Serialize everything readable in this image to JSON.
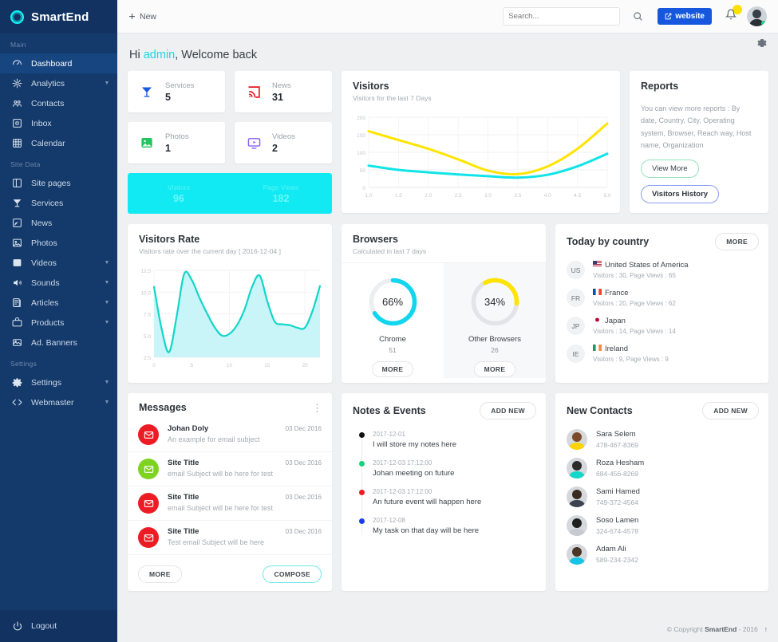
{
  "brand": {
    "name": "SmartEnd"
  },
  "sidebar": {
    "sections": [
      {
        "title": "Main",
        "items": [
          {
            "label": "Dashboard",
            "icon": "dashboard-icon",
            "caret": false,
            "active": true
          },
          {
            "label": "Analytics",
            "icon": "analytics-icon",
            "caret": true
          },
          {
            "label": "Contacts",
            "icon": "contacts-icon",
            "caret": false
          },
          {
            "label": "Inbox",
            "icon": "inbox-icon",
            "caret": false
          },
          {
            "label": "Calendar",
            "icon": "calendar-icon",
            "caret": false
          }
        ]
      },
      {
        "title": "Site Data",
        "items": [
          {
            "label": "Site pages",
            "icon": "site-pages-icon",
            "caret": false
          },
          {
            "label": "Services",
            "icon": "services-icon",
            "caret": false
          },
          {
            "label": "News",
            "icon": "news-icon",
            "caret": false
          },
          {
            "label": "Photos",
            "icon": "photos-icon",
            "caret": false
          },
          {
            "label": "Videos",
            "icon": "videos-icon",
            "caret": true
          },
          {
            "label": "Sounds",
            "icon": "sounds-icon",
            "caret": true
          },
          {
            "label": "Articles",
            "icon": "articles-icon",
            "caret": true
          },
          {
            "label": "Products",
            "icon": "products-icon",
            "caret": true
          },
          {
            "label": "Ad. Banners",
            "icon": "ad-banners-icon",
            "caret": false
          }
        ]
      },
      {
        "title": "Settings",
        "items": [
          {
            "label": "Settings",
            "icon": "gear-icon",
            "caret": true
          },
          {
            "label": "Webmaster",
            "icon": "code-icon",
            "caret": true
          }
        ]
      }
    ],
    "logout": "Logout"
  },
  "topbar": {
    "new_label": "New",
    "search_placeholder": "Search...",
    "search_value": "",
    "website_label": "website"
  },
  "welcome": {
    "hi": "Hi ",
    "user": "admin",
    "rest": ", Welcome back"
  },
  "stats": [
    {
      "label": "Services",
      "value": "5",
      "icon": "cocktail-icon",
      "color": "#1757dd"
    },
    {
      "label": "News",
      "value": "31",
      "icon": "rss-icon",
      "color": "#e8131d"
    },
    {
      "label": "Photos",
      "value": "1",
      "icon": "image-icon",
      "color": "#22c55e"
    },
    {
      "label": "Videos",
      "value": "2",
      "icon": "video-icon",
      "color": "#8b5cf6"
    }
  ],
  "banner": {
    "cells": [
      {
        "label": "Visitors",
        "value": "96"
      },
      {
        "label": "Page Views",
        "value": "182"
      }
    ]
  },
  "visitors_card": {
    "title": "Visitors",
    "subtitle": "Visitors for the last 7 Days"
  },
  "reports": {
    "title": "Reports",
    "text": "You can view more reports : By date, Country, City, Operating system, Browser, Reach way, Host name, Organization",
    "view_more": "View More",
    "visitors_history": "Visitors History"
  },
  "rate_card": {
    "title": "Visitors Rate",
    "subtitle": "Visitors rate over the current day [ 2016-12-04 ]"
  },
  "browsers": {
    "title": "Browsers",
    "subtitle": "Calculated in last 7 days",
    "items": [
      {
        "name": "Chrome",
        "percent": "66%",
        "count": "51",
        "color": "#11d6ee",
        "more": "MORE"
      },
      {
        "name": "Other Browsers",
        "percent": "34%",
        "count": "26",
        "color": "#ffe400",
        "more": "MORE"
      }
    ]
  },
  "country": {
    "title": "Today by country",
    "more": "MORE",
    "rows": [
      {
        "code": "US",
        "name": "United States of America",
        "stats": "Visitors : 30, Page Views : 65",
        "flag": "us"
      },
      {
        "code": "FR",
        "name": "France",
        "stats": "Visitors : 20, Page Views : 62",
        "flag": "fr"
      },
      {
        "code": "JP",
        "name": "Japan",
        "stats": "Visitors : 14, Page Views : 14",
        "flag": "jp"
      },
      {
        "code": "IE",
        "name": "Ireland",
        "stats": "Visitors : 9, Page Views : 9",
        "flag": "ie"
      }
    ]
  },
  "messages": {
    "title": "Messages",
    "rows": [
      {
        "name": "Johan Doly",
        "subject": "An example for email subject",
        "date": "03 Dec 2016",
        "color": "#ed1c24"
      },
      {
        "name": "Site Title",
        "subject": "email Subject will be here for test",
        "date": "03 Dec 2016",
        "color": "#7ed321"
      },
      {
        "name": "Site Title",
        "subject": "email Subject will be here for test",
        "date": "03 Dec 2016",
        "color": "#ed1c24"
      },
      {
        "name": "Site Title",
        "subject": "Test email Subject will be here",
        "date": "03 Dec 2016",
        "color": "#ed1c24"
      }
    ],
    "more": "MORE",
    "compose": "COMPOSE"
  },
  "notes": {
    "title": "Notes & Events",
    "add_new": "ADD NEW",
    "rows": [
      {
        "date": "2017-12-01",
        "text": "I will store my notes here",
        "color": "#111111"
      },
      {
        "date": "2017-12-03 17:12:00",
        "text": "Johan meeting on future",
        "color": "#19d07a"
      },
      {
        "date": "2017-12-03 17:12:00",
        "text": "An future event will happen here",
        "color": "#ee1b24"
      },
      {
        "date": "2017-12-08",
        "text": "My task on that day will be here",
        "color": "#1b3de8"
      }
    ]
  },
  "contacts": {
    "title": "New Contacts",
    "add_new": "ADD NEW",
    "rows": [
      {
        "name": "Sara Selem",
        "phone": "478-467-8369",
        "hair": "#7b4a2a",
        "cloth": "#ffd400"
      },
      {
        "name": "Roza Hesham",
        "phone": "684-456-8269",
        "hair": "#2b2b2b",
        "cloth": "#15d6c8"
      },
      {
        "name": "Sami Hamed",
        "phone": "749-372-4564",
        "hair": "#3a2b20",
        "cloth": "#3b4450"
      },
      {
        "name": "Soso Lamen",
        "phone": "324-674-4578",
        "hair": "#1f1f1f",
        "cloth": "#c7cbd1"
      },
      {
        "name": "Adam Ali",
        "phone": "589-234-2342",
        "hair": "#4a3526",
        "cloth": "#16c4e8"
      }
    ]
  },
  "footer": {
    "text": "© Copyright SmartEnd - 2016"
  },
  "chart_data": [
    {
      "type": "line",
      "title": "Visitors",
      "subtitle": "Visitors for the last 7 Days",
      "xlabel": "",
      "ylabel": "",
      "xlim": [
        1.0,
        5.0
      ],
      "ylim": [
        0,
        200
      ],
      "xticks": [
        "1.0",
        "1.5",
        "2.0",
        "2.5",
        "3.0",
        "3.5",
        "4.0",
        "4.5",
        "5.0"
      ],
      "yticks": [
        "0",
        "50",
        "100",
        "150",
        "200"
      ],
      "grid": true,
      "legend": "none",
      "x": [
        1.0,
        1.5,
        2.0,
        2.5,
        3.0,
        3.5,
        4.0,
        4.5,
        5.0
      ],
      "series": [
        {
          "name": "Page Views",
          "color": "#ffe400",
          "values": [
            160,
            135,
            110,
            80,
            48,
            38,
            60,
            110,
            182
          ]
        },
        {
          "name": "Visitors",
          "color": "#11e4e8",
          "values": [
            62,
            50,
            43,
            37,
            32,
            28,
            36,
            60,
            96
          ]
        }
      ]
    },
    {
      "type": "area",
      "title": "Visitors Rate",
      "subtitle": "Visitors rate over the current day [ 2016-12-04 ]",
      "xlabel": "",
      "ylabel": "",
      "xlim": [
        0,
        22
      ],
      "ylim": [
        2.5,
        12.5
      ],
      "xticks": [
        "0",
        "5",
        "10",
        "15",
        "20"
      ],
      "yticks": [
        "2.5",
        "5.0",
        "7.5",
        "10.0",
        "12.5"
      ],
      "grid": true,
      "legend": "none",
      "color": "#11d6c8",
      "x": [
        0,
        1,
        2,
        3,
        4,
        5,
        6,
        7,
        8,
        9,
        10,
        11,
        12,
        13,
        14,
        15,
        16,
        17,
        18,
        19,
        20,
        21,
        22
      ],
      "values": [
        10.6,
        5.8,
        3.1,
        7.2,
        12.1,
        11.4,
        9.4,
        7.6,
        6.0,
        5.0,
        5.2,
        6.2,
        8.0,
        10.6,
        11.9,
        9.0,
        6.6,
        6.3,
        6.2,
        5.9,
        5.9,
        7.8,
        10.7
      ]
    },
    {
      "type": "pie",
      "title": "Chrome",
      "labels": [
        "Chrome",
        "Remaining"
      ],
      "values": [
        66,
        34
      ],
      "display": "66%",
      "count": 51,
      "colors": [
        "#11d6ee",
        "#eceef0"
      ]
    },
    {
      "type": "pie",
      "title": "Other Browsers",
      "labels": [
        "Other Browsers",
        "Remaining"
      ],
      "values": [
        34,
        66
      ],
      "display": "34%",
      "count": 26,
      "colors": [
        "#ffe400",
        "#eceef0"
      ]
    }
  ]
}
